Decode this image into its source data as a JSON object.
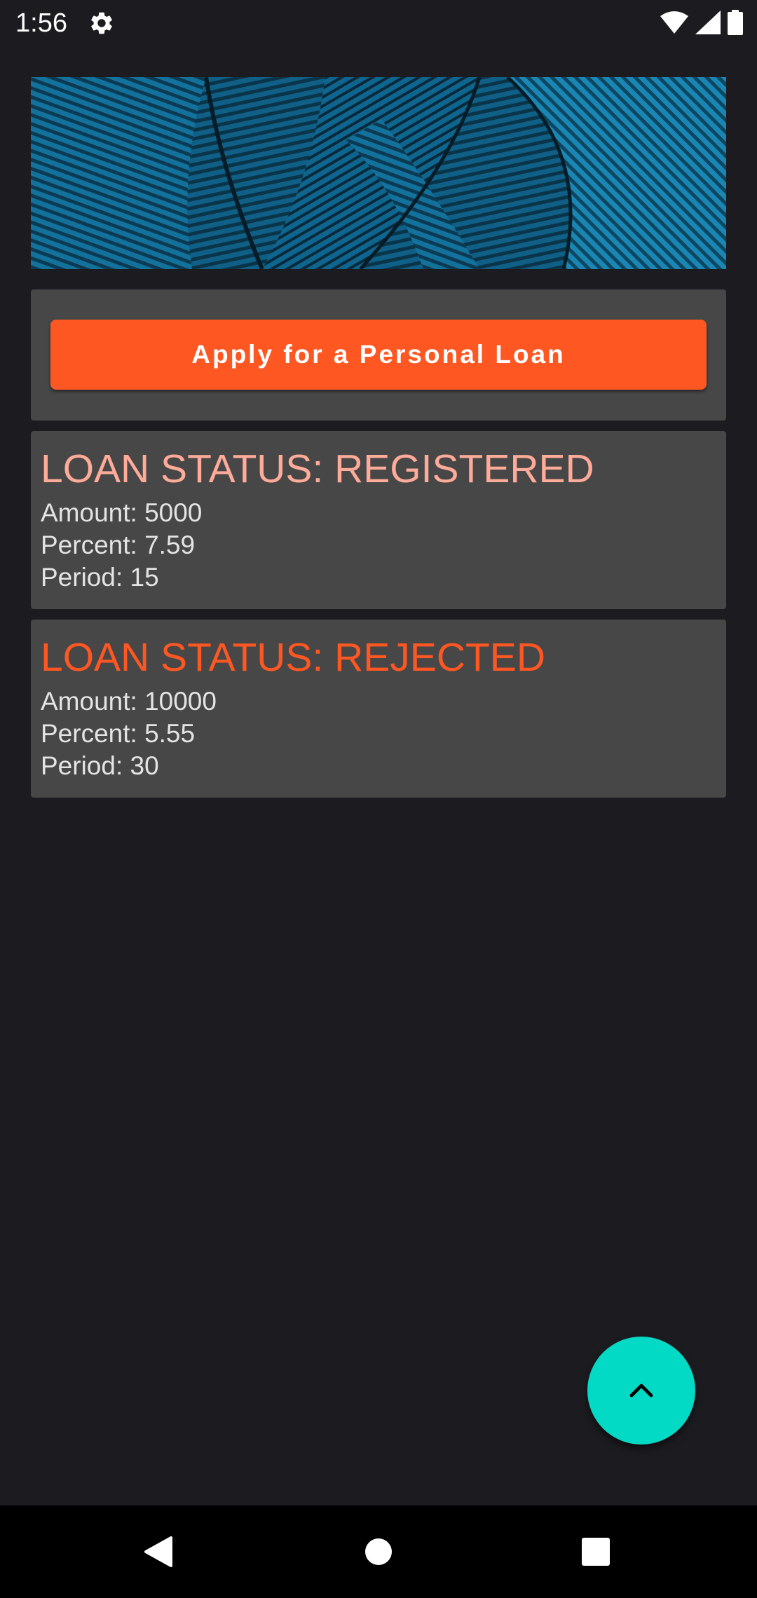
{
  "status_bar": {
    "time": "1:56",
    "icons": [
      "gear-icon",
      "wifi-icon",
      "signal-icon",
      "battery-icon"
    ]
  },
  "banner": {
    "image": "blue-feather-texture"
  },
  "apply": {
    "button_label": "Apply for a Personal Loan"
  },
  "loans": [
    {
      "status": "LOAN STATUS: REGISTERED",
      "status_color": "#ffab9a",
      "amount": "Amount: 5000",
      "percent": "Percent: 7.59",
      "period": "Period: 15"
    },
    {
      "status": "LOAN STATUS: REJECTED",
      "status_color": "#ff5722",
      "amount": "Amount: 10000",
      "percent": "Percent: 5.55",
      "period": "Period: 30"
    }
  ],
  "fab": {
    "icon": "chevron-up-icon",
    "color": "#03dac5"
  },
  "nav_bar": {
    "icons": [
      "back-icon",
      "home-icon",
      "recents-icon"
    ]
  },
  "colors": {
    "background": "#1c1b20",
    "card": "#474747",
    "accent": "#ff5722"
  }
}
